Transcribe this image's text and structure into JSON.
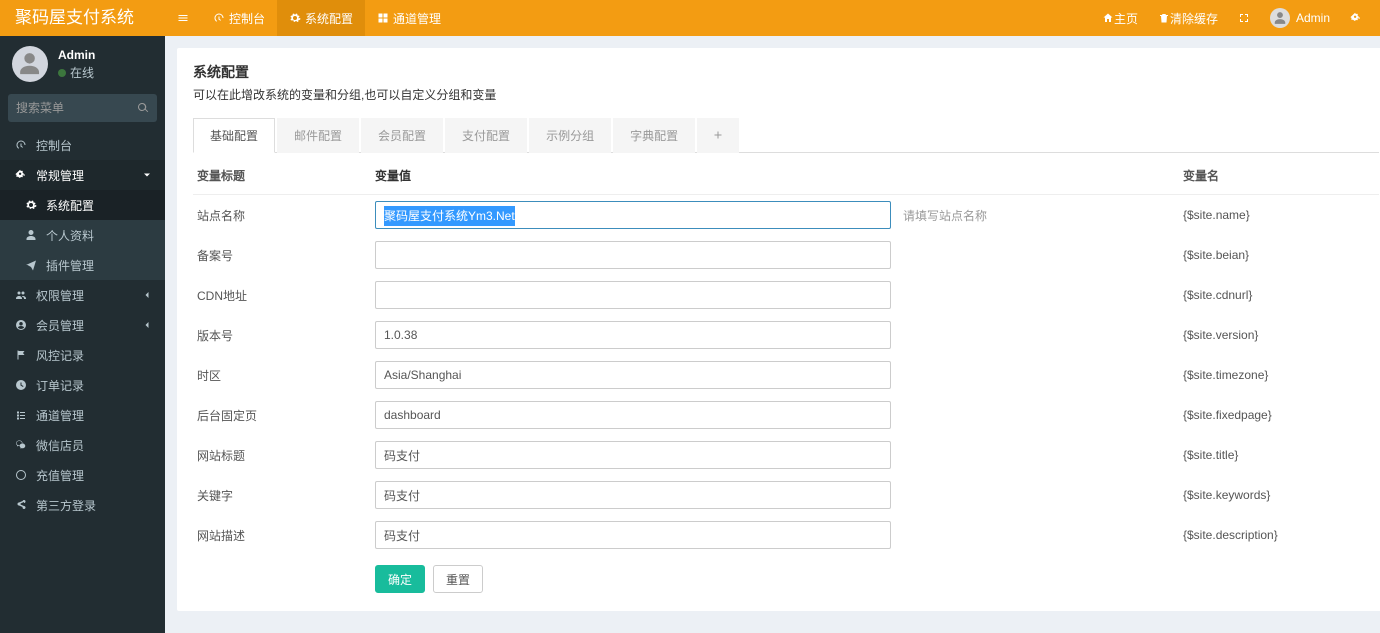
{
  "brand": "聚码屋支付系统",
  "topnav": {
    "toggle_icon": "bars",
    "items": [
      {
        "icon": "dashboard",
        "label": "控制台"
      },
      {
        "icon": "gear",
        "label": "系统配置"
      },
      {
        "icon": "th",
        "label": "通道管理"
      }
    ],
    "active_index": 1
  },
  "topright": {
    "home": "主页",
    "clear_cache": "清除缓存",
    "username": "Admin"
  },
  "user_panel": {
    "name": "Admin",
    "status": "在线"
  },
  "search_placeholder": "搜索菜单",
  "sidebar": {
    "items": [
      {
        "icon": "dashboard",
        "label": "控制台"
      },
      {
        "icon": "cogs",
        "label": "常规管理",
        "expandable": true,
        "open": true,
        "children": [
          {
            "icon": "gear",
            "label": "系统配置",
            "active": true
          },
          {
            "icon": "user",
            "label": "个人资料"
          },
          {
            "icon": "plane",
            "label": "插件管理"
          }
        ]
      },
      {
        "icon": "group",
        "label": "权限管理",
        "expandable": true
      },
      {
        "icon": "user-circle",
        "label": "会员管理",
        "expandable": true
      },
      {
        "icon": "flag",
        "label": "风控记录"
      },
      {
        "icon": "clock",
        "label": "订单记录"
      },
      {
        "icon": "list",
        "label": "通道管理"
      },
      {
        "icon": "wechat",
        "label": "微信店员"
      },
      {
        "icon": "circle-o",
        "label": "充值管理"
      },
      {
        "icon": "share",
        "label": "第三方登录"
      }
    ]
  },
  "page": {
    "title": "系统配置",
    "subtitle": "可以在此增改系统的变量和分组,也可以自定义分组和变量"
  },
  "tabs": {
    "items": [
      "基础配置",
      "邮件配置",
      "会员配置",
      "支付配置",
      "示例分组",
      "字典配置"
    ],
    "active_index": 0
  },
  "table": {
    "headers": {
      "label": "变量标题",
      "value": "变量值",
      "var": "变量名"
    },
    "rows": [
      {
        "label": "站点名称",
        "value": "聚码屋支付系统Ym3.Net",
        "tip": "请填写站点名称",
        "var": "{$site.name}",
        "selected": true
      },
      {
        "label": "备案号",
        "value": "",
        "tip": "",
        "var": "{$site.beian}"
      },
      {
        "label": "CDN地址",
        "value": "",
        "tip": "",
        "var": "{$site.cdnurl}"
      },
      {
        "label": "版本号",
        "value": "1.0.38",
        "tip": "",
        "var": "{$site.version}"
      },
      {
        "label": "时区",
        "value": "Asia/Shanghai",
        "tip": "",
        "var": "{$site.timezone}"
      },
      {
        "label": "后台固定页",
        "value": "dashboard",
        "tip": "",
        "var": "{$site.fixedpage}"
      },
      {
        "label": "网站标题",
        "value": "码支付",
        "tip": "",
        "var": "{$site.title}"
      },
      {
        "label": "关键字",
        "value": "码支付",
        "tip": "",
        "var": "{$site.keywords}"
      },
      {
        "label": "网站描述",
        "value": "码支付",
        "tip": "",
        "var": "{$site.description}"
      }
    ]
  },
  "buttons": {
    "ok": "确定",
    "reset": "重置"
  }
}
